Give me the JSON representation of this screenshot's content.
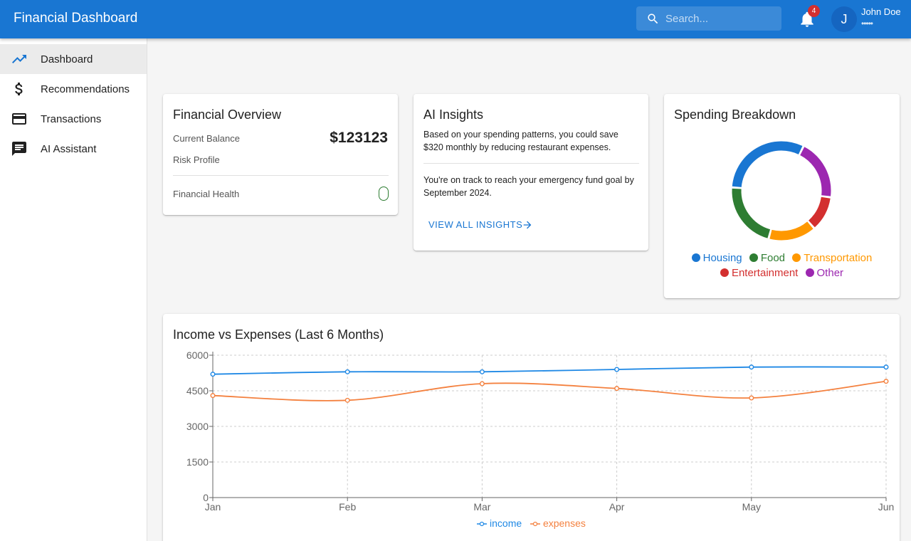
{
  "app": {
    "title": "Financial Dashboard"
  },
  "search": {
    "placeholder": "Search..."
  },
  "notifications": {
    "count": "4",
    "icon": "bell-icon"
  },
  "user": {
    "initial": "J",
    "name": "John Doe",
    "subtitle": "•••••"
  },
  "sidebar": {
    "items": [
      {
        "label": "Dashboard",
        "icon": "trending-up-icon",
        "active": true
      },
      {
        "label": "Recommendations",
        "icon": "dollar-icon",
        "active": false
      },
      {
        "label": "Transactions",
        "icon": "credit-card-icon",
        "active": false
      },
      {
        "label": "AI Assistant",
        "icon": "chat-icon",
        "active": false
      }
    ]
  },
  "overview": {
    "title": "Financial Overview",
    "balance_label": "Current Balance",
    "balance_value": "$123123",
    "risk_label": "Risk Profile",
    "health_label": "Financial Health"
  },
  "insights": {
    "title": "AI Insights",
    "items": [
      "Based on your spending patterns, you could save $320 monthly by reducing restaurant expenses.",
      "You're on track to reach your emergency fund goal by September 2024."
    ],
    "link_label": "VIEW ALL INSIGHTS"
  },
  "spending": {
    "title": "Spending Breakdown"
  },
  "colors": {
    "primary": "#1976d2",
    "housing": "#1976d2",
    "food": "#2e7d32",
    "transportation": "#ff9800",
    "entertainment": "#d32f2f",
    "other": "#9c27b0",
    "income": "#1e88e5",
    "expenses": "#f4813f"
  },
  "chart_data": [
    {
      "type": "pie",
      "title": "Spending Breakdown",
      "donut": true,
      "categories": [
        "Housing",
        "Food",
        "Transportation",
        "Entertainment",
        "Other"
      ],
      "values": [
        30,
        21,
        15,
        11,
        19
      ],
      "legend": "bottom"
    },
    {
      "type": "line",
      "title": "Income vs Expenses (Last 6 Months)",
      "categories": [
        "Jan",
        "Feb",
        "Mar",
        "Apr",
        "May",
        "Jun"
      ],
      "series": [
        {
          "name": "income",
          "values": [
            5200,
            5300,
            5300,
            5400,
            5500,
            5500
          ]
        },
        {
          "name": "expenses",
          "values": [
            4300,
            4100,
            4800,
            4600,
            4200,
            4900
          ]
        }
      ],
      "yticks": [
        "0",
        "1500",
        "3000",
        "4500",
        "6000"
      ],
      "ylim": [
        0,
        6000
      ],
      "grid": true,
      "legend": "bottom"
    }
  ]
}
